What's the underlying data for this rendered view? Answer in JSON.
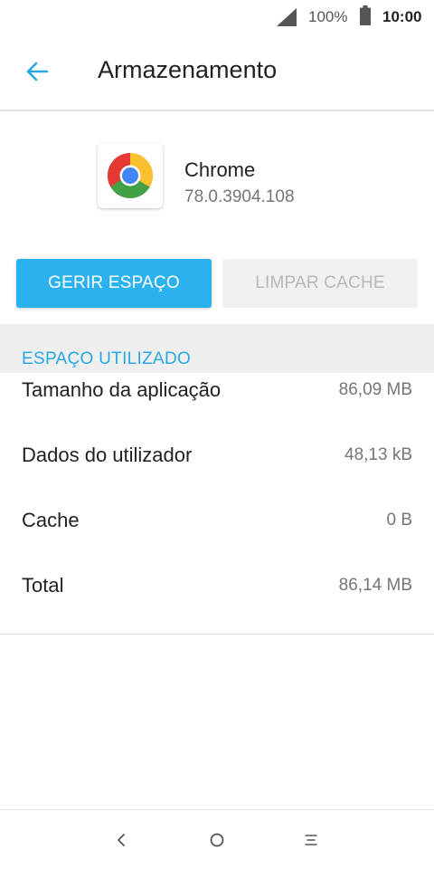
{
  "status_bar": {
    "battery_percent": "100%",
    "time": "10:00"
  },
  "header": {
    "title": "Armazenamento",
    "back_icon": "arrow-left-icon"
  },
  "app": {
    "name": "Chrome",
    "version": "78.0.3904.108",
    "icon": "chrome-logo-icon"
  },
  "buttons": {
    "manage_space": "GERIR ESPAÇO",
    "clear_cache": "LIMPAR CACHE"
  },
  "storage": {
    "section_title": "ESPAÇO UTILIZADO",
    "rows": [
      {
        "label": "Tamanho da aplicação",
        "value": "86,09 MB"
      },
      {
        "label": "Dados do utilizador",
        "value": "48,13 kB"
      },
      {
        "label": "Cache",
        "value": "0 B"
      },
      {
        "label": "Total",
        "value": "86,14 MB"
      }
    ]
  },
  "colors": {
    "accent": "#2ab1ee",
    "section_header": "#29a8e6",
    "disabled_button_bg": "#f0f0f0",
    "disabled_button_text": "#b8b8b8"
  },
  "nav_bar": {
    "back": "nav-back-icon",
    "home": "nav-home-icon",
    "recents": "nav-recents-icon"
  }
}
